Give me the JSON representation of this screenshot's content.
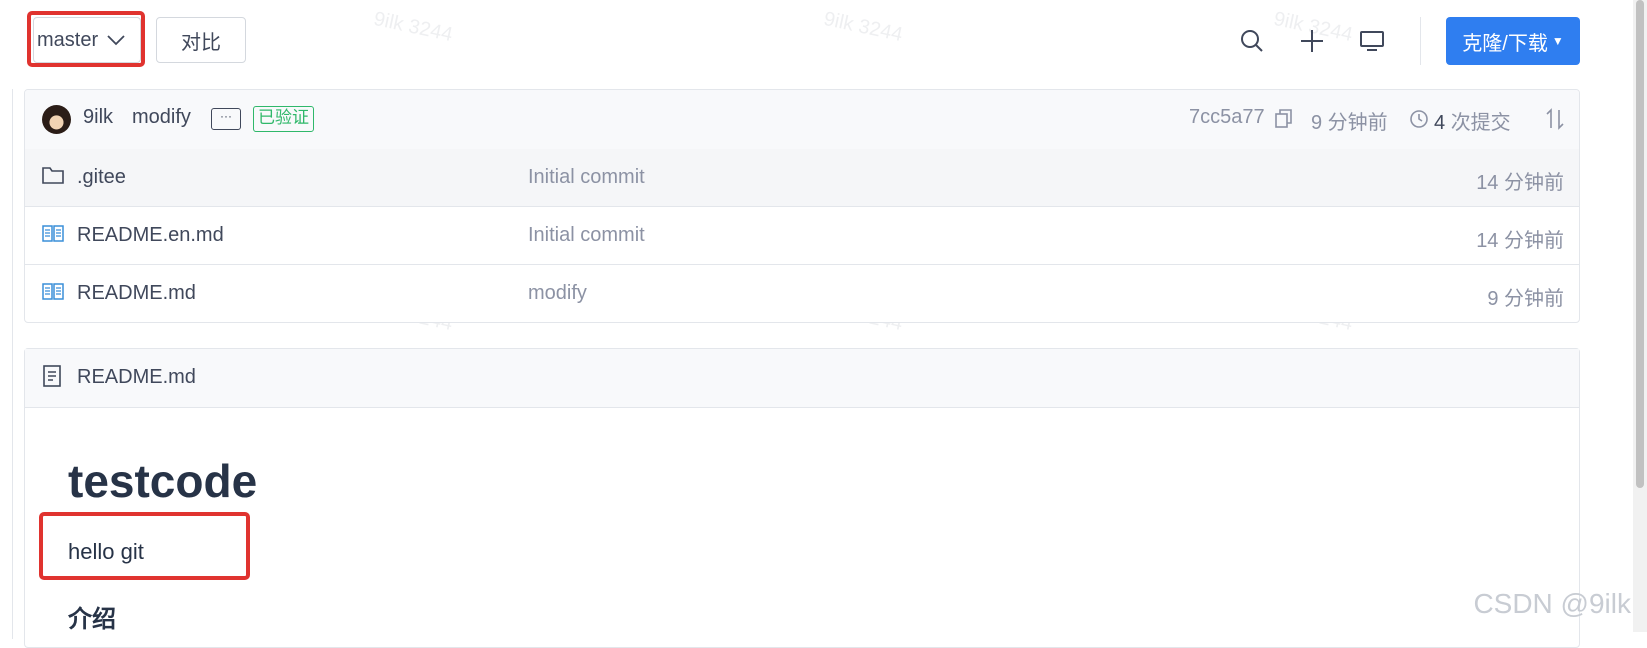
{
  "toolbar": {
    "branch": "master",
    "compare_label": "对比",
    "clone_label": "克隆/下载"
  },
  "commit": {
    "author": "9ilk",
    "message": "modify",
    "more": "···",
    "verified": "已验证",
    "hash": "7cc5a77",
    "time": "9 分钟前",
    "count": "4",
    "count_suffix": "次提交"
  },
  "files": [
    {
      "name": ".gitee",
      "type": "folder",
      "message": "Initial commit",
      "time": "14 分钟前"
    },
    {
      "name": "README.en.md",
      "type": "markdown",
      "message": "Initial commit",
      "time": "14 分钟前"
    },
    {
      "name": "README.md",
      "type": "markdown",
      "message": "modify",
      "time": "9 分钟前"
    }
  ],
  "readme": {
    "filename": "README.md",
    "title": "testcode",
    "paragraph": "hello git",
    "section": "介绍"
  },
  "watermark": "9ilk 3244",
  "credit": "CSDN @9ilk",
  "colors": {
    "accent": "#2f7ef0",
    "highlight": "#e0332f",
    "verified": "#2fb86a"
  }
}
